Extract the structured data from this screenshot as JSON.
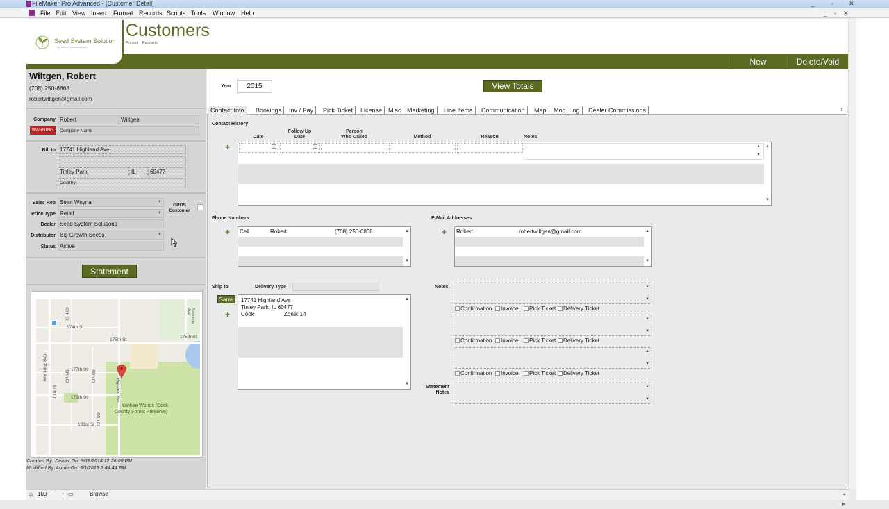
{
  "window": {
    "title": "FileMaker Pro Advanced - [Customer Detail]",
    "controls": [
      "_",
      "▫",
      "✕"
    ],
    "inner_controls": [
      "_",
      "▫",
      "✕"
    ]
  },
  "menu": [
    "File",
    "Edit",
    "View",
    "Insert",
    "Format",
    "Records",
    "Scripts",
    "Tools",
    "Window",
    "Help"
  ],
  "header": {
    "logo_text": "Seed System Solution",
    "logo_sub": "by Seed Consultants Inc.",
    "title": "Customers",
    "found": "Found 1 Records",
    "new_label": "New",
    "delete_label": "Delete/Void"
  },
  "customer": {
    "name": "Wiltgen, Robert",
    "phone": "(708) 250-6868",
    "email": "robertwiltgen@gmail.com",
    "company_label": "Company",
    "first": "Robert",
    "last": "Wiltgen",
    "warning": "WARNING",
    "company_name_placeholder": "Company Name",
    "billto_label": "Bill to",
    "address1": "17741 Highland Ave",
    "city": "Tinley Park",
    "state": "IL",
    "zip": "60477",
    "country_placeholder": "Country",
    "sales_rep_label": "Sales Rep",
    "sales_rep": "Sean Woyna",
    "price_type_label": "Price Type",
    "price_type": "Retail",
    "dealer_label": "Dealer",
    "dealer": "Seed System Solutions",
    "distributor_label": "Distributor",
    "distributor": "Big Growth Seeds",
    "status_label": "Status",
    "status": "Active",
    "gpos_label": "GPOS",
    "gpos_label2": "Customer",
    "statement_label": "Statement",
    "created": "Created By: Dealer On: 9/18/2014 12:26:05 PM",
    "modified": "Modified By:Annie On: 6/1/2015 2:44:44 PM"
  },
  "map": {
    "labels": [
      "174th St",
      "175th St",
      "175th St",
      "177th St",
      "179th St",
      "181st St",
      "Oak Park Ave",
      "67th Ct",
      "68th Ct",
      "66th Ct",
      "68th Ct",
      "64th Ct",
      "Highland Ave",
      "Parkside Ave",
      "Yankee Woods (Cook",
      "County Forest Preserve)"
    ]
  },
  "main": {
    "year_label": "Year",
    "year": "2015",
    "view_totals": "View Totals",
    "tabs": [
      "Contact Info",
      "Bookings",
      "Inv / Pay",
      "Pick Ticket",
      "License",
      "Misc",
      "Marketing",
      "Line Items",
      "Communication",
      "Map",
      "Mod. Log",
      "Dealer Commissions"
    ],
    "contact_history": "Contact History",
    "ch_cols": {
      "date": "Date",
      "followup1": "Follow Up",
      "followup2": "Date",
      "person1": "Person",
      "person2": "Who Called",
      "method": "Method",
      "reason": "Reason",
      "notes": "Notes"
    },
    "phone_numbers": "Phone Numbers",
    "phone_row": {
      "type": "Cell",
      "name": "Robert",
      "number": "(708) 250-6868"
    },
    "email_addresses": "E-Mail Addresses",
    "email_row": {
      "name": "Robert",
      "email": "robertwiltgen@gmail.com"
    },
    "ship_to": "Ship to",
    "delivery_type": "Delivery Type",
    "same": "Same",
    "ship_line1": "17741 Highland Ave",
    "ship_line2": "Tinley Park, IL 60477",
    "ship_county": "Cook",
    "ship_zone": "Zone:  14",
    "notes_label": "Notes",
    "chk_confirmation": "Confirmation",
    "chk_invoice": "Invoice",
    "chk_pick": "Pick Ticket",
    "chk_delivery": "Delivery Ticket",
    "statement_notes1": "Statement",
    "statement_notes2": "Notes"
  },
  "status": {
    "zoom": "100",
    "mode": "Browse"
  }
}
